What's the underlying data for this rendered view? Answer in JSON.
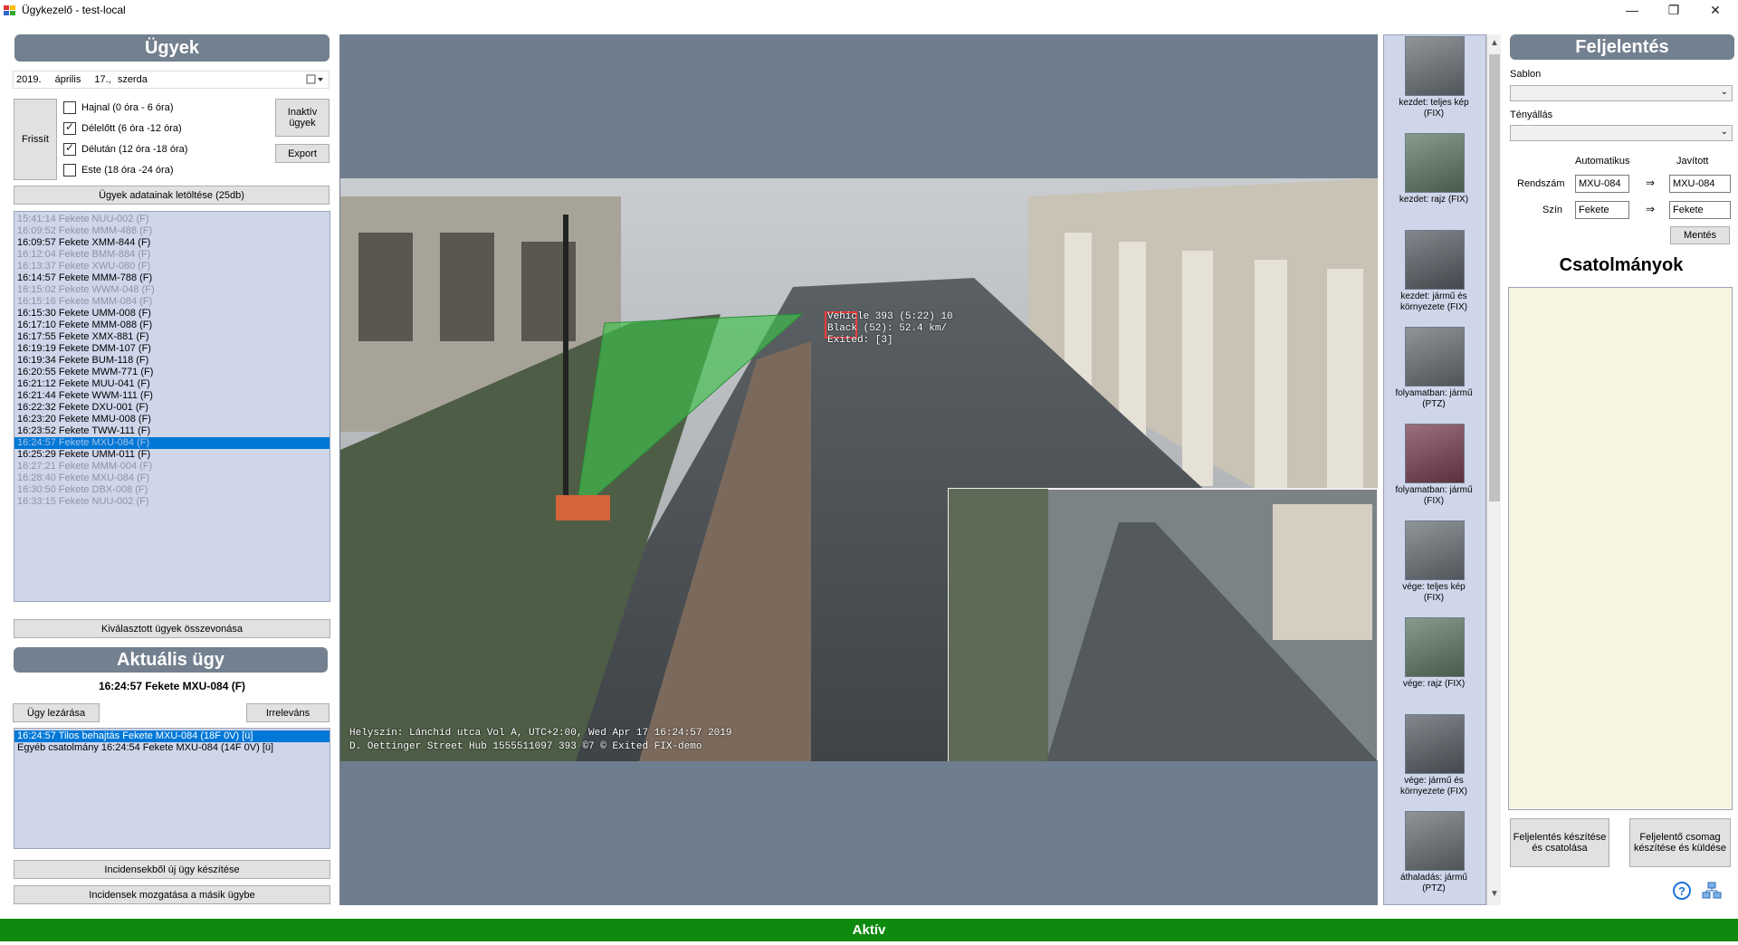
{
  "window": {
    "title": "Ügykezelő - test-local",
    "min": "—",
    "max": "❐",
    "close": "✕"
  },
  "left": {
    "header": "Ügyek",
    "date": {
      "year": "2019.",
      "month": "április",
      "day": "17.,",
      "weekday": "szerda"
    },
    "refresh": "Frissít",
    "filters": [
      {
        "label": "Hajnal (0 óra - 6 óra)",
        "checked": false
      },
      {
        "label": "Délelőtt (6 óra -12 óra)",
        "checked": true
      },
      {
        "label": "Délután (12 óra -18 óra)",
        "checked": true
      },
      {
        "label": "Este (18 óra -24 óra)",
        "checked": false
      }
    ],
    "inactive_btn": "Inaktív ügyek",
    "export_btn": "Export",
    "download_btn": "Ügyek adatainak letöltése (25db)",
    "cases": [
      {
        "text": "15:41:14 Fekete NUU-002 (F)",
        "state": "inactive"
      },
      {
        "text": "16:09:52 Fekete MMM-488 (F)",
        "state": "inactive"
      },
      {
        "text": "16:09:57 Fekete XMM-844 (F)",
        "state": "active"
      },
      {
        "text": "16:12:04 Fekete BMM-884 (F)",
        "state": "inactive"
      },
      {
        "text": "16:13:37 Fekete XWU-080 (F)",
        "state": "inactive"
      },
      {
        "text": "16:14:57 Fekete MMM-788 (F)",
        "state": "active"
      },
      {
        "text": "16:15:02 Fekete WWM-048 (F)",
        "state": "inactive"
      },
      {
        "text": "16:15:16 Fekete MMM-084 (F)",
        "state": "inactive"
      },
      {
        "text": "16:15:30 Fekete UMM-008 (F)",
        "state": "active"
      },
      {
        "text": "16:17:10 Fekete MMM-088 (F)",
        "state": "active"
      },
      {
        "text": "16:17:55 Fekete XMX-881 (F)",
        "state": "active"
      },
      {
        "text": "16:19:19 Fekete DMM-107 (F)",
        "state": "active"
      },
      {
        "text": "16:19:34 Fekete BUM-118 (F)",
        "state": "active"
      },
      {
        "text": "16:20:55 Fekete MWM-771 (F)",
        "state": "active"
      },
      {
        "text": "16:21:12 Fekete MUU-041 (F)",
        "state": "active"
      },
      {
        "text": "16:21:44 Fekete WWM-111 (F)",
        "state": "active"
      },
      {
        "text": "16:22:32 Fekete DXU-001 (F)",
        "state": "active"
      },
      {
        "text": "16:23:20 Fekete MMU-008 (F)",
        "state": "active"
      },
      {
        "text": "16:23:52 Fekete TWW-111 (F)",
        "state": "active"
      },
      {
        "text": "16:24:57 Fekete MXU-084 (F)",
        "state": "selected"
      },
      {
        "text": "16:25:29 Fekete UMM-011 (F)",
        "state": "active"
      },
      {
        "text": "16:27:21 Fekete MMM-004 (F)",
        "state": "inactive"
      },
      {
        "text": "16:28:40 Fekete MXU-084 (F)",
        "state": "inactive"
      },
      {
        "text": "16:30:50 Fekete DBX-008 (F)",
        "state": "inactive"
      },
      {
        "text": "16:33:15 Fekete NUU-002 (F)",
        "state": "inactive"
      }
    ],
    "merge_btn": "Kiválasztott ügyek összevonása",
    "current_header": "Aktuális ügy",
    "current_case": "16:24:57 Fekete MXU-084 (F)",
    "close_btn": "Ügy lezárása",
    "irrelevant_btn": "Irreleváns",
    "incidents": [
      {
        "text": "16:24:57 Tilos behajtás Fekete MXU-084 (18F 0V) [ü]",
        "state": "sel2"
      },
      {
        "text": "Egyéb csatolmány 16:24:54 Fekete MXU-084 (14F 0V) [ü]",
        "state": "active"
      }
    ],
    "new_case_btn": "Incidensekből új ügy készítése",
    "move_btn": "Incidensek mozgatása a másik ügybe"
  },
  "video": {
    "overlay_line1": "Helyszín: Lánchíd utca    Vol A, UTC+2:00, Wed Apr 17 16:24:57 2019",
    "overlay_line2": "D. Oettinger Street Hub 1555511097 393 ©7 © Exited FIX-demo",
    "detect_lines": [
      "Vehicle 393 (5:22) 10",
      "Black (52): 52.4 km/",
      "Exited: [3]"
    ]
  },
  "thumbs": [
    {
      "caption": "kezdet: teljes kép (FIX)"
    },
    {
      "caption": "kezdet: rajz (FIX)"
    },
    {
      "caption": "kezdet: jármű és környezete (FIX)"
    },
    {
      "caption": "folyamatban: jármű (PTZ)"
    },
    {
      "caption": "folyamatban: jármű (FIX)"
    },
    {
      "caption": "vége: teljes kép (FIX)"
    },
    {
      "caption": "vége: rajz (FIX)"
    },
    {
      "caption": "vége: jármű és környezete (FIX)"
    },
    {
      "caption": "áthaladás: jármű (PTZ)"
    }
  ],
  "right": {
    "header": "Feljelentés",
    "template_label": "Sablon",
    "facts_label": "Tényállás",
    "auto_label": "Automatikus",
    "fixed_label": "Javított",
    "plate_label": "Rendszám",
    "plate_auto": "MXU-084",
    "plate_fixed": "MXU-084",
    "color_label": "Szín",
    "color_auto": "Fekete",
    "color_fixed": "Fekete",
    "arrow": "⇒",
    "save_btn": "Mentés",
    "attachments_header": "Csatolmányok",
    "make_btn": "Feljelentés készítése és csatolása",
    "send_btn": "Feljelentő csomag készítése és küldése"
  },
  "status": {
    "text": "Aktív",
    "color": "#0e8a0e"
  },
  "colors": {
    "header": "#73808f",
    "list": "#cfd6ea",
    "video_bg": "#6f7e8e",
    "thumb_bg": "#cfd6ea"
  }
}
